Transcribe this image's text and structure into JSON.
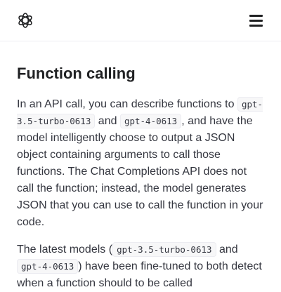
{
  "header": {
    "logo_icon": "openai-logo-icon",
    "menu_icon": "hamburger-menu-icon"
  },
  "page": {
    "title": "Function calling",
    "p1": {
      "t1": "In an API call, you can describe functions to ",
      "c1": "gpt-3.5-turbo-0613",
      "t2": " and ",
      "c2": "gpt-4-0613",
      "t3": ", and have the model intelligently choose to output a JSON object containing arguments to call those functions. The Chat Completions API does not call the function; instead, the model generates JSON that you can use to call the function in your code."
    },
    "p2": {
      "t1": "The latest models (",
      "c1": "gpt-3.5-turbo-0613",
      "t2": " and ",
      "c2": "gpt-4-0613",
      "t3": ") have been fine-tuned to both detect when a function should to be called"
    }
  },
  "colors": {
    "text": "#353740",
    "heading": "#202123",
    "code_bg": "#f7f7f8",
    "divider": "#ececf1"
  }
}
